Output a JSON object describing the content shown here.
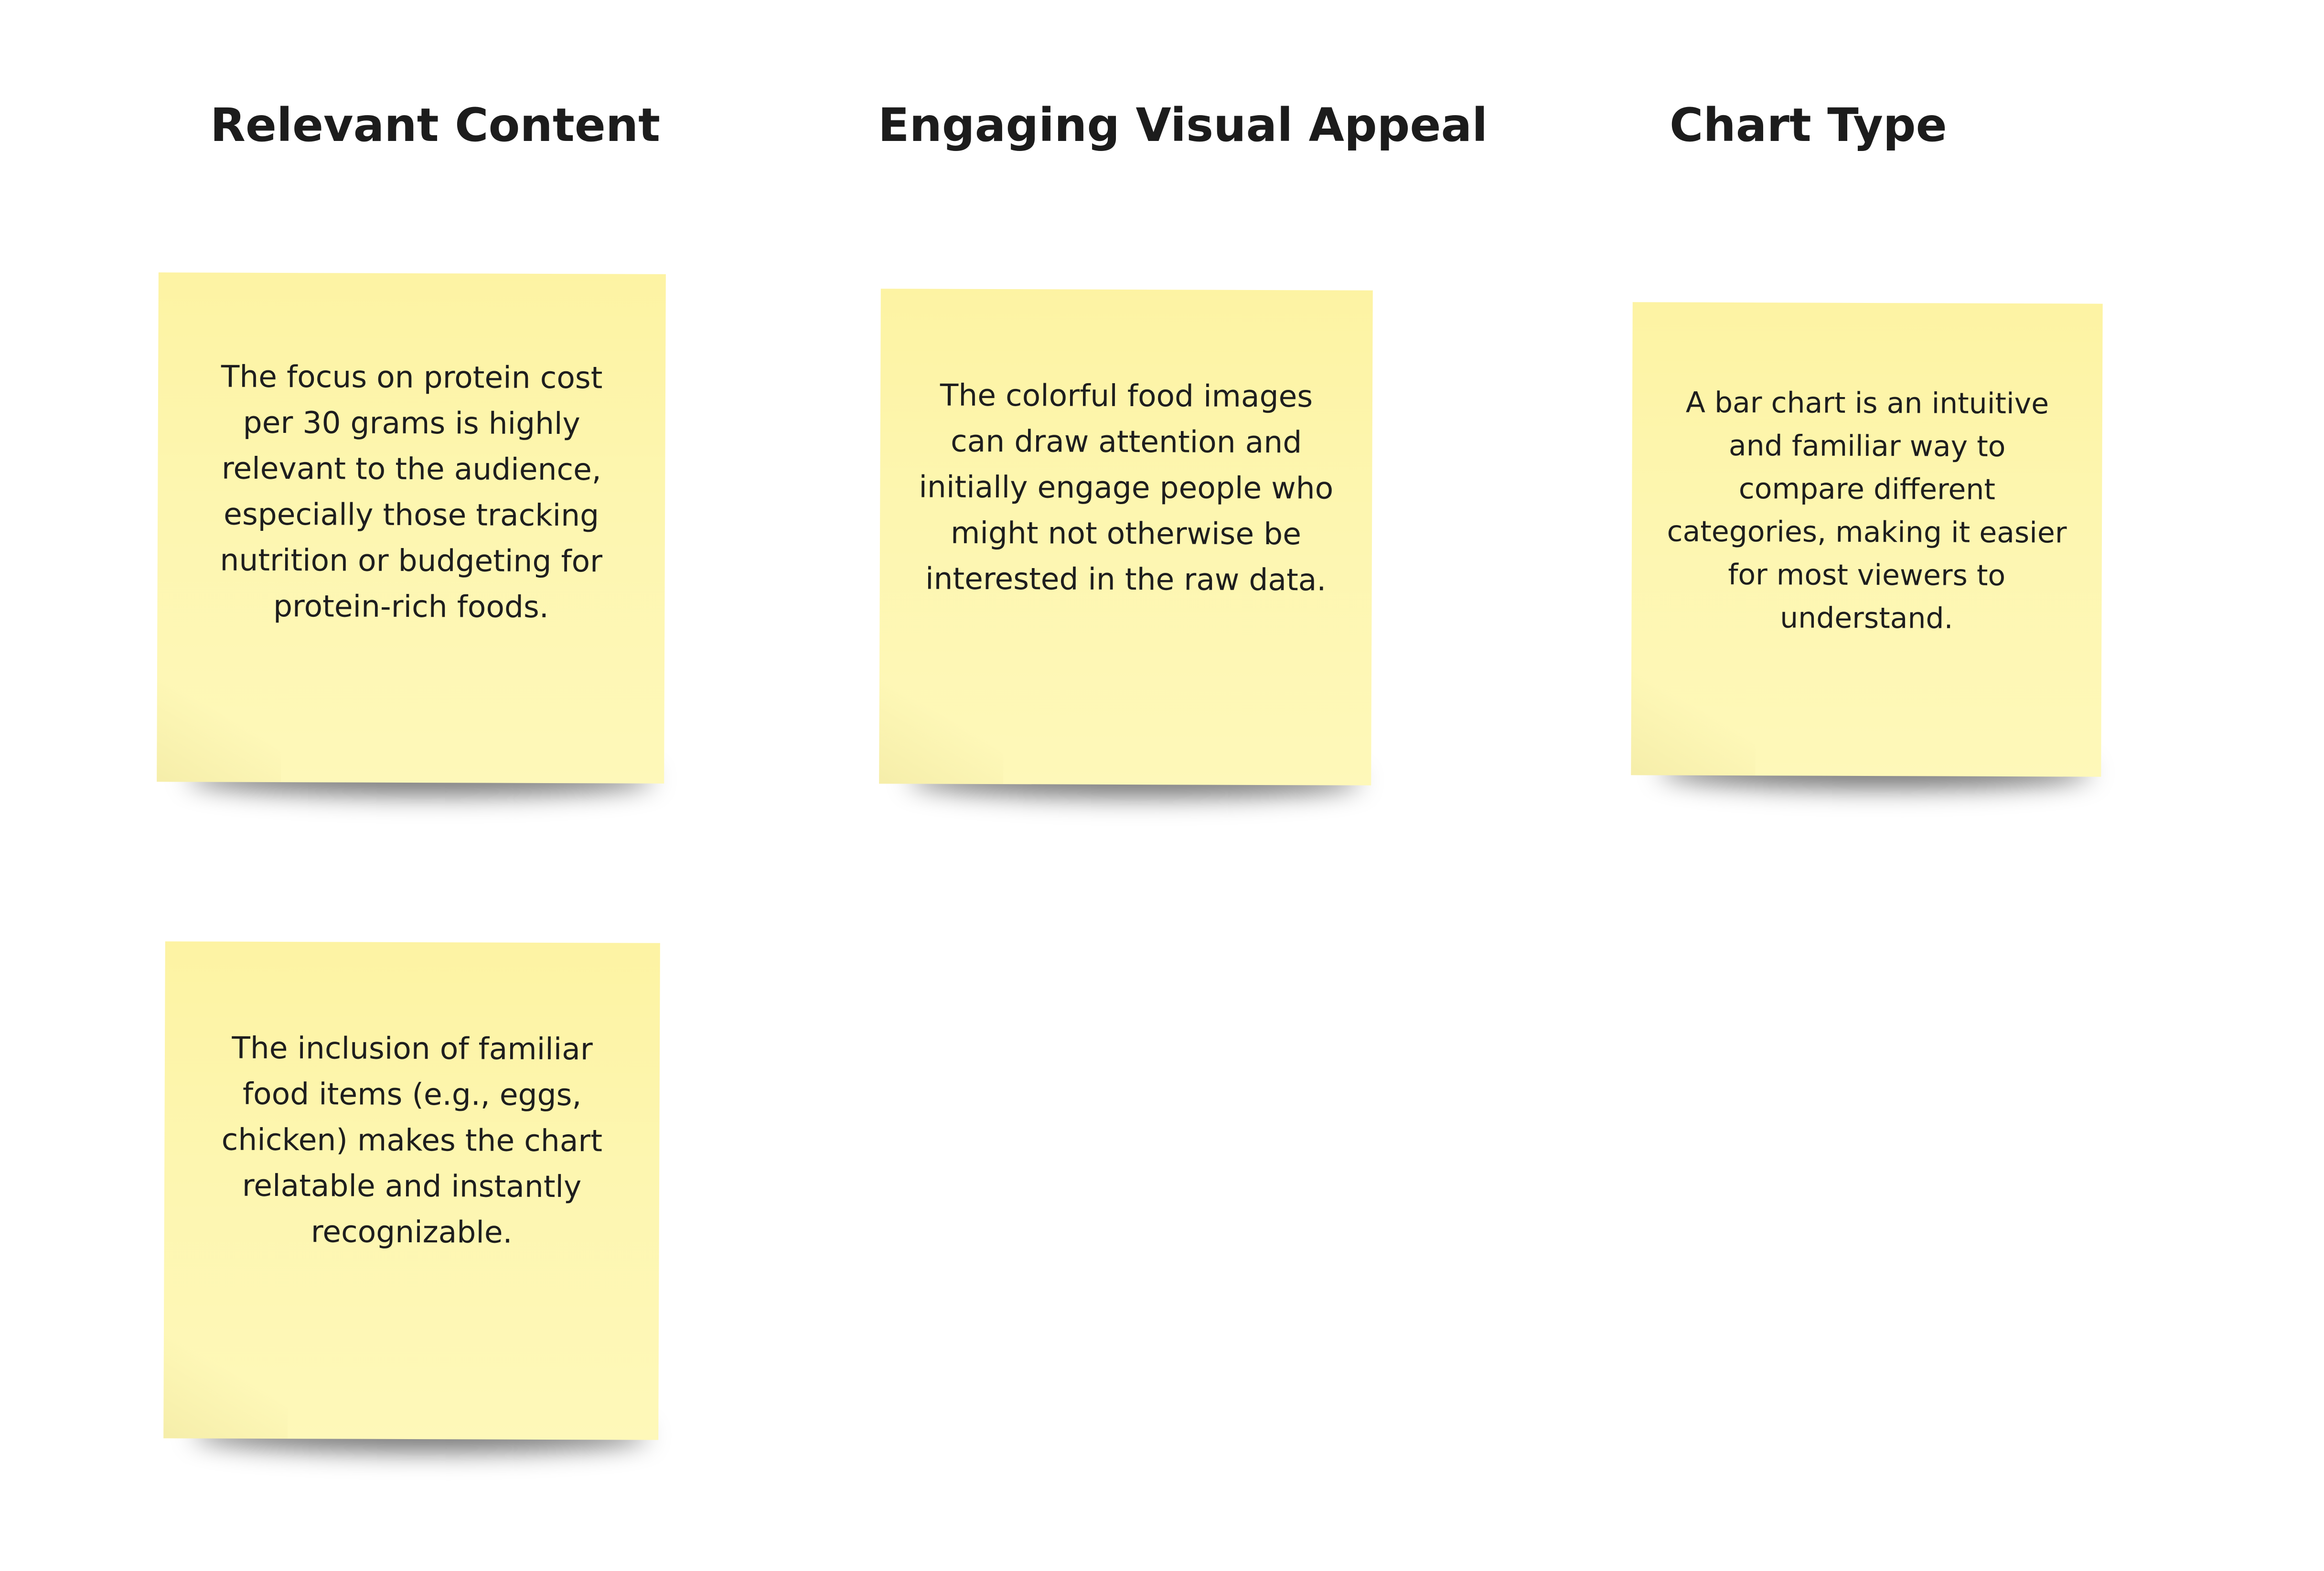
{
  "columns": [
    {
      "heading": "Relevant Content",
      "notes": [
        "The focus on protein cost per 30 grams is highly relevant to the audience, especially those tracking nutrition or budgeting for protein-rich foods.",
        "The inclusion of familiar food items (e.g., eggs, chicken) makes the chart relatable and instantly recognizable."
      ]
    },
    {
      "heading": "Engaging Visual Appeal",
      "notes": [
        "The colorful food images can draw attention and initially engage people who might not otherwise be interested in the raw data."
      ]
    },
    {
      "heading": "Chart Type",
      "notes": [
        "A bar chart is an intuitive and familiar way to compare different categories, making it easier for most viewers to understand."
      ]
    }
  ],
  "colors": {
    "background": "#ffffff",
    "note": "#fdf6b0",
    "text": "#1e1e1e"
  }
}
